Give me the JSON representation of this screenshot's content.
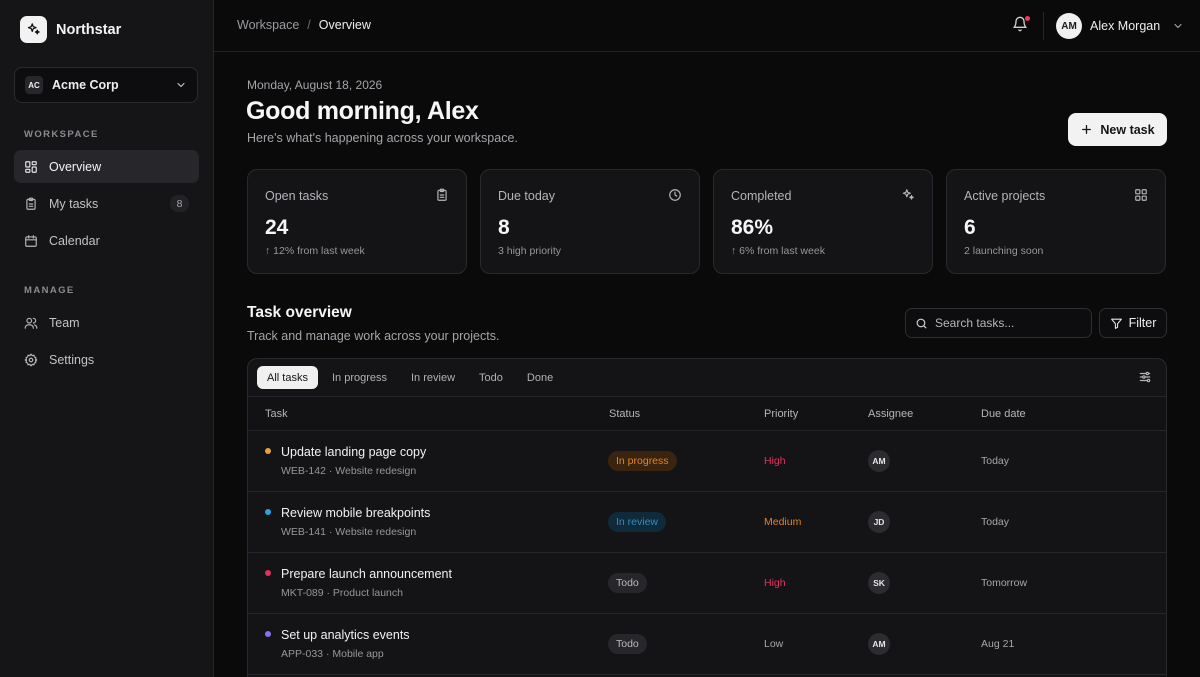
{
  "app": {
    "name": "Northstar"
  },
  "org": {
    "badge": "AC",
    "name": "Acme Corp"
  },
  "nav": {
    "workspace_title": "WORKSPACE",
    "manage_title": "MANAGE",
    "items": [
      {
        "label": "Overview",
        "icon": "grid-icon",
        "active": true
      },
      {
        "label": "My tasks",
        "icon": "clipboard-icon",
        "count": "8"
      },
      {
        "label": "Calendar",
        "icon": "calendar-icon"
      },
      {
        "label": "Team",
        "icon": "users-icon"
      },
      {
        "label": "Settings",
        "icon": "gear-icon"
      }
    ]
  },
  "topbar": {
    "breadcrumb_root": "Workspace",
    "breadcrumb_sep": "/",
    "breadcrumb_current": "Overview",
    "user_initials": "AM",
    "user_name": "Alex Morgan",
    "notification_dot_color": "#ef3a5d"
  },
  "header": {
    "date": "Monday, August 18, 2026",
    "greeting": "Good morning, Alex",
    "subtitle": "Here's what's happening across your workspace.",
    "new_task_label": "New task"
  },
  "stats": [
    {
      "label": "Open tasks",
      "value": "24",
      "note": "↑ 12% from last week",
      "icon": "clipboard-icon"
    },
    {
      "label": "Due today",
      "value": "8",
      "note": "3 high priority",
      "icon": "clock-icon"
    },
    {
      "label": "Completed",
      "value": "86%",
      "note": "↑ 6% from last week",
      "icon": "sparkle-icon"
    },
    {
      "label": "Active projects",
      "value": "6",
      "note": "2 launching soon",
      "icon": "grid-icon"
    }
  ],
  "tasks": {
    "title": "Task overview",
    "subtitle": "Track and manage work across your projects.",
    "search_placeholder": "Search tasks...",
    "filter_label": "Filter",
    "tabs": [
      "All tasks",
      "In progress",
      "In review",
      "Todo",
      "Done"
    ],
    "active_tab": "All tasks",
    "columns": [
      "Task",
      "Status",
      "Priority",
      "Assignee",
      "Due date"
    ],
    "rows": [
      {
        "title": "Update landing page copy",
        "meta": "WEB-142 · Website redesign",
        "dot": "#e9a23b",
        "status": "In progress",
        "priority": "High",
        "assignee": "AM",
        "due": "Today"
      },
      {
        "title": "Review mobile breakpoints",
        "meta": "WEB-141 · Website redesign",
        "dot": "#2ba3e0",
        "status": "In review",
        "priority": "Medium",
        "assignee": "JD",
        "due": "Today"
      },
      {
        "title": "Prepare launch announcement",
        "meta": "MKT-089 · Product launch",
        "dot": "#e6305b",
        "status": "Todo",
        "priority": "High",
        "assignee": "SK",
        "due": "Tomorrow"
      },
      {
        "title": "Set up analytics events",
        "meta": "APP-033 · Mobile app",
        "dot": "#8a6df0",
        "status": "Todo",
        "priority": "Low",
        "assignee": "AM",
        "due": "Aug 21"
      }
    ]
  }
}
